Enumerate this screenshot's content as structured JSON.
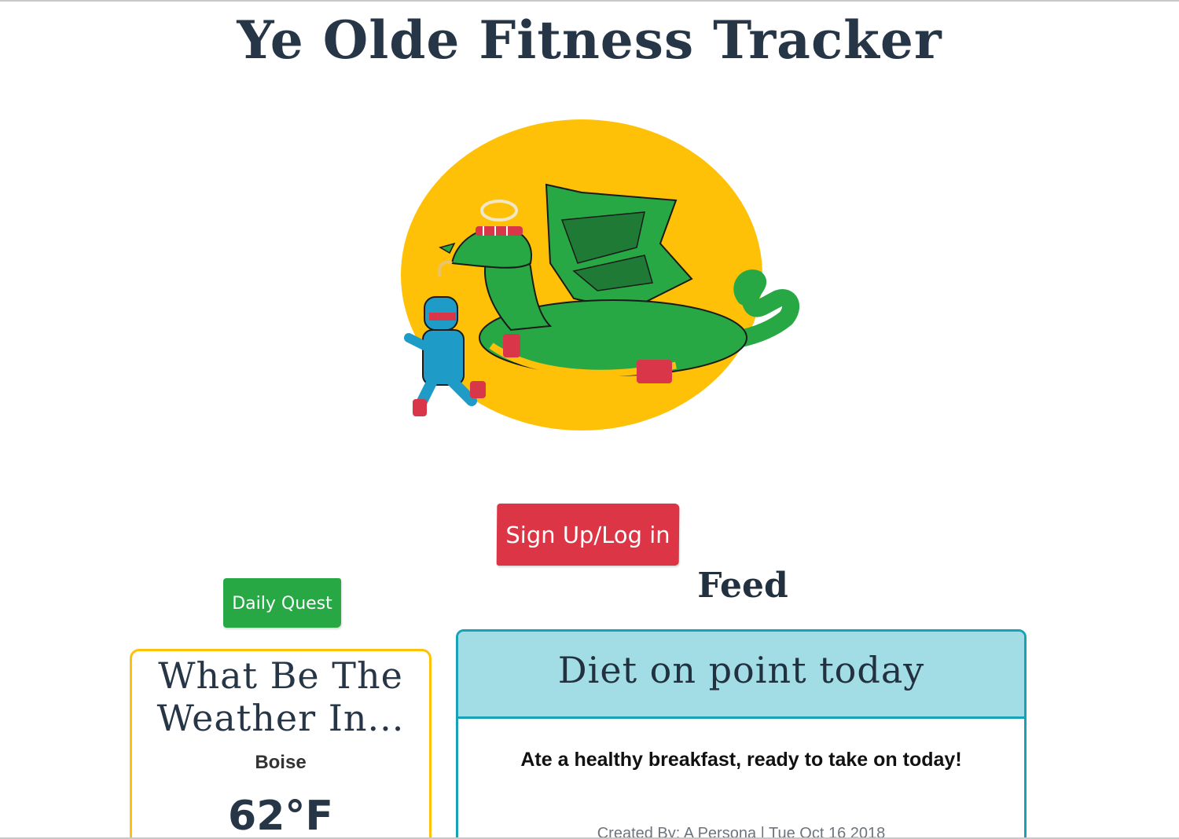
{
  "header": {
    "title": "Ye Olde Fitness Tracker"
  },
  "hero": {
    "image_name": "knight-and-dragon-illustration",
    "colors": {
      "sun": "#ffc107",
      "dragon": "#27a844",
      "dragon_dark": "#1e7a34",
      "knight": "#1e9bc7",
      "sweatband": "#d9364a"
    }
  },
  "actions": {
    "login_label": "Sign Up/Log in",
    "daily_quest_label": "Daily Quest"
  },
  "weather": {
    "title": "What Be The Weather In...",
    "city": "Boise",
    "temperature": "62°F"
  },
  "feed": {
    "heading": "Feed",
    "posts": [
      {
        "title": "Diet on point today",
        "body": "Ate a healthy breakfast, ready to take on today!",
        "meta": "Created By: A Persona | Tue Oct 16 2018"
      }
    ]
  },
  "colors": {
    "login_button": "#dc3545",
    "quest_button": "#28a745",
    "weather_border": "#ffc107",
    "feed_border": "#17a2b8",
    "feed_header_bg": "#a2dde6",
    "text_dark": "#263646"
  }
}
